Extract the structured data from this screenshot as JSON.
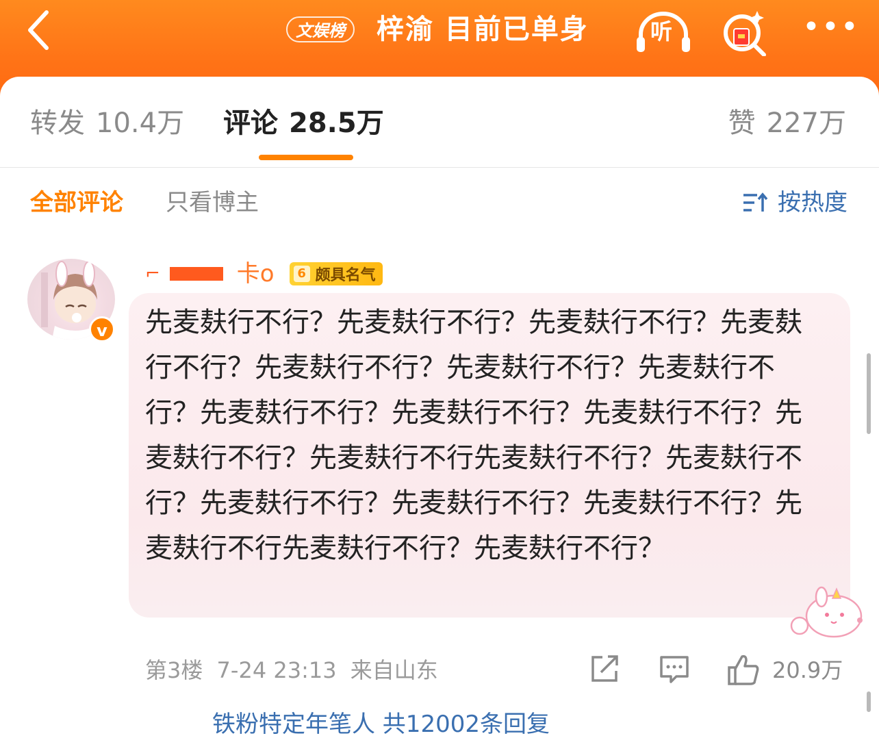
{
  "header": {
    "topic_badge": "文娱榜",
    "topic_title": "梓渝 目前已单身",
    "listen_label": "听",
    "more_label": "•••"
  },
  "tabs": {
    "repost_label": "转发",
    "repost_count": "10.4万",
    "comment_label": "评论",
    "comment_count": "28.5万",
    "like_label": "赞",
    "like_count": "227万"
  },
  "filters": {
    "all_label": "全部评论",
    "owner_label": "只看博主",
    "sort_label": "按热度"
  },
  "comment": {
    "username": "卡o",
    "level": "6",
    "level_title": "颇具名气",
    "verified_label": "v",
    "text": "先麦麸行不行？先麦麸行不行？先麦麸行不行？先麦麸行不行？先麦麸行不行？先麦麸行不行？先麦麸行不行？先麦麸行不行？先麦麸行不行？先麦麸行不行？先麦麸行不行？先麦麸行不行先麦麸行不行？先麦麸行不行？先麦麸行不行？先麦麸行不行？先麦麸行不行？先麦麸行不行先麦麸行不行？先麦麸行不行？",
    "floor": "第3楼",
    "time": "7-24 23:13",
    "location": "来自山东",
    "like_count": "20.9万"
  },
  "footer": {
    "hint": "铁粉特定年笔人 共12002条回复"
  },
  "colors": {
    "brand_orange": "#ff8200",
    "link_blue": "#3a6fb0"
  }
}
